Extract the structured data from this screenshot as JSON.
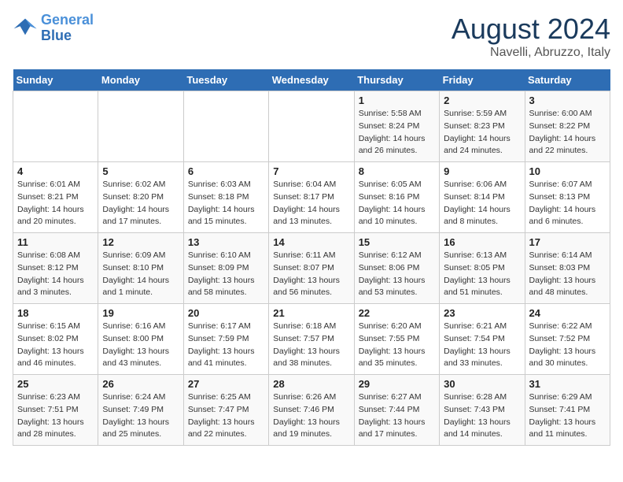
{
  "header": {
    "logo_line1": "General",
    "logo_line2": "Blue",
    "month": "August 2024",
    "location": "Navelli, Abruzzo, Italy"
  },
  "weekdays": [
    "Sunday",
    "Monday",
    "Tuesday",
    "Wednesday",
    "Thursday",
    "Friday",
    "Saturday"
  ],
  "weeks": [
    [
      {
        "day": "",
        "info": ""
      },
      {
        "day": "",
        "info": ""
      },
      {
        "day": "",
        "info": ""
      },
      {
        "day": "",
        "info": ""
      },
      {
        "day": "1",
        "info": "Sunrise: 5:58 AM\nSunset: 8:24 PM\nDaylight: 14 hours\nand 26 minutes."
      },
      {
        "day": "2",
        "info": "Sunrise: 5:59 AM\nSunset: 8:23 PM\nDaylight: 14 hours\nand 24 minutes."
      },
      {
        "day": "3",
        "info": "Sunrise: 6:00 AM\nSunset: 8:22 PM\nDaylight: 14 hours\nand 22 minutes."
      }
    ],
    [
      {
        "day": "4",
        "info": "Sunrise: 6:01 AM\nSunset: 8:21 PM\nDaylight: 14 hours\nand 20 minutes."
      },
      {
        "day": "5",
        "info": "Sunrise: 6:02 AM\nSunset: 8:20 PM\nDaylight: 14 hours\nand 17 minutes."
      },
      {
        "day": "6",
        "info": "Sunrise: 6:03 AM\nSunset: 8:18 PM\nDaylight: 14 hours\nand 15 minutes."
      },
      {
        "day": "7",
        "info": "Sunrise: 6:04 AM\nSunset: 8:17 PM\nDaylight: 14 hours\nand 13 minutes."
      },
      {
        "day": "8",
        "info": "Sunrise: 6:05 AM\nSunset: 8:16 PM\nDaylight: 14 hours\nand 10 minutes."
      },
      {
        "day": "9",
        "info": "Sunrise: 6:06 AM\nSunset: 8:14 PM\nDaylight: 14 hours\nand 8 minutes."
      },
      {
        "day": "10",
        "info": "Sunrise: 6:07 AM\nSunset: 8:13 PM\nDaylight: 14 hours\nand 6 minutes."
      }
    ],
    [
      {
        "day": "11",
        "info": "Sunrise: 6:08 AM\nSunset: 8:12 PM\nDaylight: 14 hours\nand 3 minutes."
      },
      {
        "day": "12",
        "info": "Sunrise: 6:09 AM\nSunset: 8:10 PM\nDaylight: 14 hours\nand 1 minute."
      },
      {
        "day": "13",
        "info": "Sunrise: 6:10 AM\nSunset: 8:09 PM\nDaylight: 13 hours\nand 58 minutes."
      },
      {
        "day": "14",
        "info": "Sunrise: 6:11 AM\nSunset: 8:07 PM\nDaylight: 13 hours\nand 56 minutes."
      },
      {
        "day": "15",
        "info": "Sunrise: 6:12 AM\nSunset: 8:06 PM\nDaylight: 13 hours\nand 53 minutes."
      },
      {
        "day": "16",
        "info": "Sunrise: 6:13 AM\nSunset: 8:05 PM\nDaylight: 13 hours\nand 51 minutes."
      },
      {
        "day": "17",
        "info": "Sunrise: 6:14 AM\nSunset: 8:03 PM\nDaylight: 13 hours\nand 48 minutes."
      }
    ],
    [
      {
        "day": "18",
        "info": "Sunrise: 6:15 AM\nSunset: 8:02 PM\nDaylight: 13 hours\nand 46 minutes."
      },
      {
        "day": "19",
        "info": "Sunrise: 6:16 AM\nSunset: 8:00 PM\nDaylight: 13 hours\nand 43 minutes."
      },
      {
        "day": "20",
        "info": "Sunrise: 6:17 AM\nSunset: 7:59 PM\nDaylight: 13 hours\nand 41 minutes."
      },
      {
        "day": "21",
        "info": "Sunrise: 6:18 AM\nSunset: 7:57 PM\nDaylight: 13 hours\nand 38 minutes."
      },
      {
        "day": "22",
        "info": "Sunrise: 6:20 AM\nSunset: 7:55 PM\nDaylight: 13 hours\nand 35 minutes."
      },
      {
        "day": "23",
        "info": "Sunrise: 6:21 AM\nSunset: 7:54 PM\nDaylight: 13 hours\nand 33 minutes."
      },
      {
        "day": "24",
        "info": "Sunrise: 6:22 AM\nSunset: 7:52 PM\nDaylight: 13 hours\nand 30 minutes."
      }
    ],
    [
      {
        "day": "25",
        "info": "Sunrise: 6:23 AM\nSunset: 7:51 PM\nDaylight: 13 hours\nand 28 minutes."
      },
      {
        "day": "26",
        "info": "Sunrise: 6:24 AM\nSunset: 7:49 PM\nDaylight: 13 hours\nand 25 minutes."
      },
      {
        "day": "27",
        "info": "Sunrise: 6:25 AM\nSunset: 7:47 PM\nDaylight: 13 hours\nand 22 minutes."
      },
      {
        "day": "28",
        "info": "Sunrise: 6:26 AM\nSunset: 7:46 PM\nDaylight: 13 hours\nand 19 minutes."
      },
      {
        "day": "29",
        "info": "Sunrise: 6:27 AM\nSunset: 7:44 PM\nDaylight: 13 hours\nand 17 minutes."
      },
      {
        "day": "30",
        "info": "Sunrise: 6:28 AM\nSunset: 7:43 PM\nDaylight: 13 hours\nand 14 minutes."
      },
      {
        "day": "31",
        "info": "Sunrise: 6:29 AM\nSunset: 7:41 PM\nDaylight: 13 hours\nand 11 minutes."
      }
    ]
  ]
}
